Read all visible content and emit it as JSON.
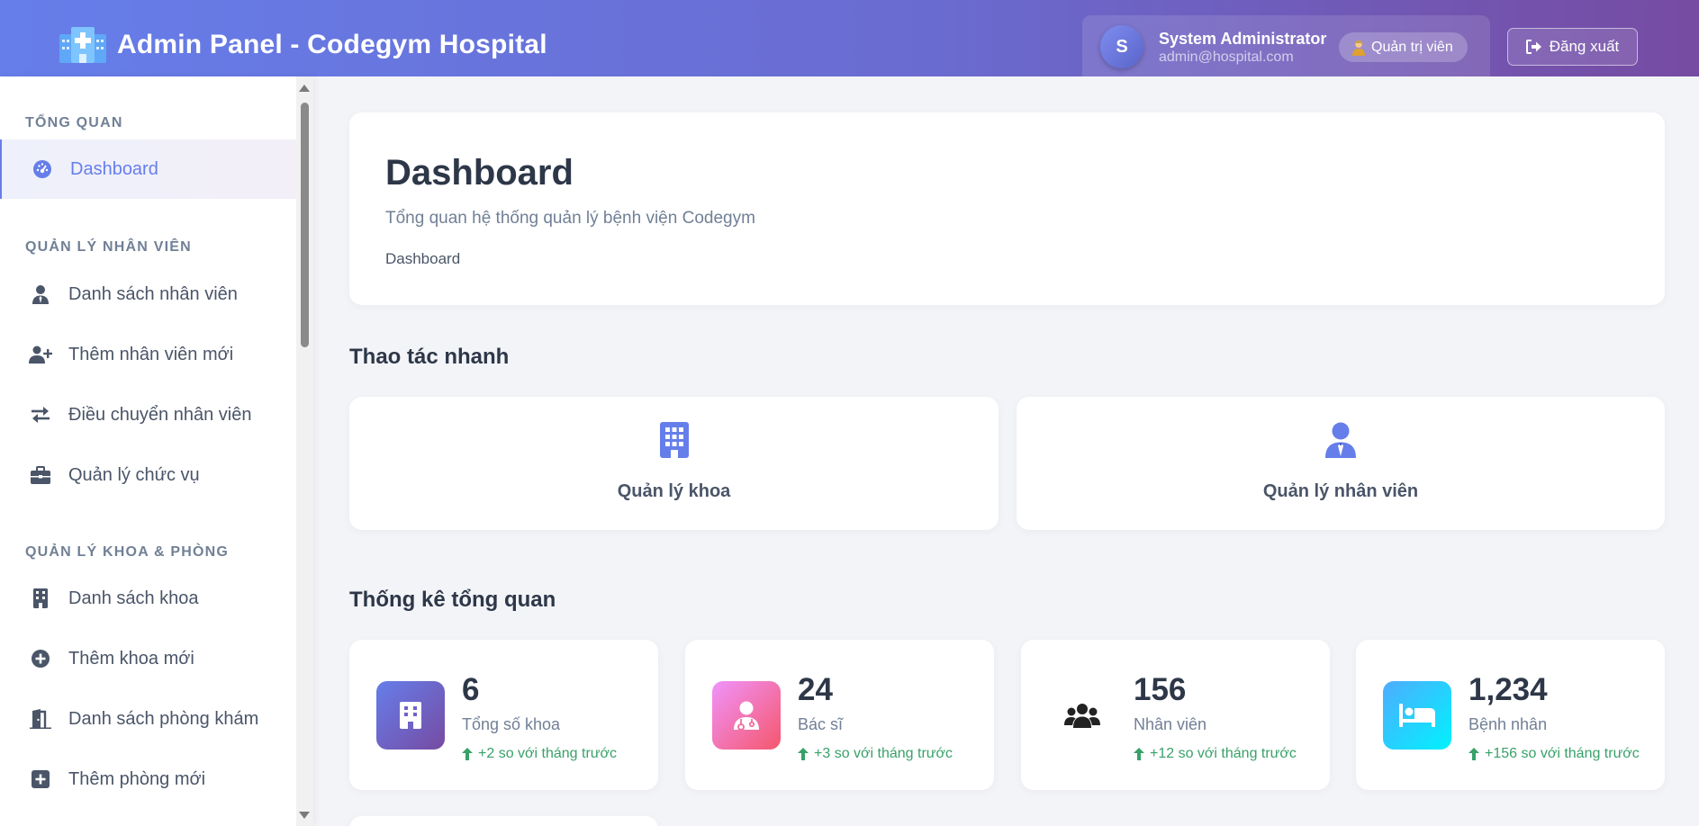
{
  "header": {
    "title": "Admin Panel - Codegym Hospital",
    "logo_icon": "hospital-icon",
    "user": {
      "avatar_initial": "S",
      "name": "System Administrator",
      "email": "admin@hospital.com",
      "role": "Quản trị viên"
    },
    "logout_label": "Đăng xuất"
  },
  "sidebar": {
    "sections": [
      {
        "title": "TỔNG QUAN",
        "items": [
          {
            "label": "Dashboard",
            "icon": "gauge-icon",
            "active": true
          }
        ]
      },
      {
        "title": "QUẢN LÝ NHÂN VIÊN",
        "items": [
          {
            "label": "Danh sách nhân viên",
            "icon": "user-tie-icon"
          },
          {
            "label": "Thêm nhân viên mới",
            "icon": "user-plus-icon"
          },
          {
            "label": "Điều chuyển nhân viên",
            "icon": "exchange-icon"
          },
          {
            "label": "Quản lý chức vụ",
            "icon": "briefcase-icon"
          }
        ]
      },
      {
        "title": "QUẢN LÝ KHOA & PHÒNG",
        "items": [
          {
            "label": "Danh sách khoa",
            "icon": "building-icon"
          },
          {
            "label": "Thêm khoa mới",
            "icon": "plus-circle-icon"
          },
          {
            "label": "Danh sách phòng khám",
            "icon": "door-open-icon"
          },
          {
            "label": "Thêm phòng mới",
            "icon": "plus-square-icon"
          }
        ]
      }
    ]
  },
  "main": {
    "page_title": "Dashboard",
    "page_subtitle": "Tổng quan hệ thống quản lý bệnh viện Codegym",
    "breadcrumb": "Dashboard",
    "quick_actions_title": "Thao tác nhanh",
    "quick_actions": [
      {
        "label": "Quản lý khoa",
        "icon": "building-icon"
      },
      {
        "label": "Quản lý nhân viên",
        "icon": "user-tie-icon"
      }
    ],
    "stats_title": "Thống kê tổng quan",
    "stats": [
      {
        "value": "6",
        "label": "Tổng số khoa",
        "change": "+2 so với tháng trước",
        "icon": "building-icon"
      },
      {
        "value": "24",
        "label": "Bác sĩ",
        "change": "+3 so với tháng trước",
        "icon": "user-doctor-icon"
      },
      {
        "value": "156",
        "label": "Nhân viên",
        "change": "+12 so với tháng trước",
        "icon": "users-icon"
      },
      {
        "value": "1,234",
        "label": "Bệnh nhân",
        "change": "+156 so với tháng trước",
        "icon": "bed-icon"
      }
    ]
  },
  "colors": {
    "accent": "#667eea",
    "header_gradient_start": "#667eea",
    "header_gradient_end": "#764ba2",
    "positive": "#38a169"
  }
}
